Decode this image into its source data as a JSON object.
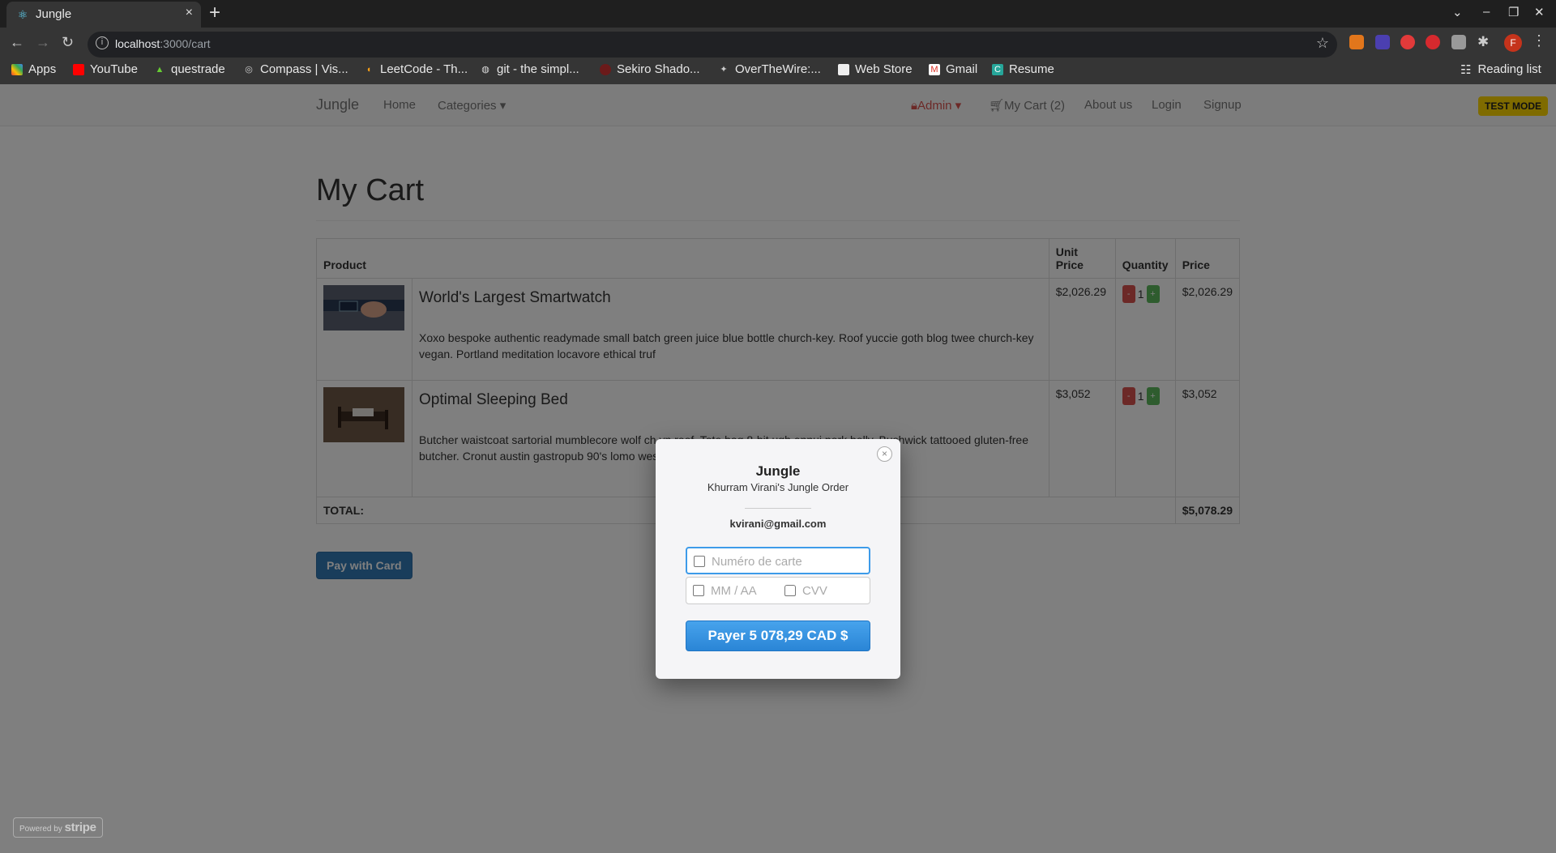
{
  "browser": {
    "tab_title": "Jungle",
    "tab_close": "×",
    "new_tab": "+",
    "url_host": "localhost",
    "url_path": ":3000/cart",
    "bookmarks": [
      "Apps",
      "YouTube",
      "questrade",
      "Compass | Vis...",
      "LeetCode - Th...",
      "git - the simpl...",
      "Sekiro Shado...",
      "OverTheWire:...",
      "Web Store",
      "Gmail",
      "Resume"
    ],
    "reading_list": "Reading list",
    "profile_initial": "F"
  },
  "navbar": {
    "brand": "Jungle",
    "home": "Home",
    "categories": "Categories ▾",
    "admin": "Admin ▾",
    "cart": "My Cart (2)",
    "about": "About us",
    "login": "Login",
    "signup": "Signup"
  },
  "test_mode": "TEST MODE",
  "page_title": "My Cart",
  "table": {
    "headers": {
      "product": "Product",
      "unit_price": "Unit Price",
      "quantity": "Quantity",
      "price": "Price"
    },
    "rows": [
      {
        "name": "World's Largest Smartwatch",
        "description": "Xoxo bespoke authentic readymade small batch green juice blue bottle church-key. Roof yuccie goth blog twee church-key vegan. Portland meditation locavore ethical truf",
        "unit_price": "$2,026.29",
        "quantity": "1",
        "price": "$2,026.29"
      },
      {
        "name": "Optimal Sleeping Bed",
        "description": "Butcher waistcoat sartorial mumblecore wolf ch                                                                              yn roof. Tote bag 8-bit ugh ennui pork belly. Bushwick tattooed gluten-free                                                              butcher. Cronut austin gastropub 90's lomo wes anderson hashtag tac",
        "unit_price": "$3,052",
        "quantity": "1",
        "price": "$3,052"
      }
    ],
    "minus": "-",
    "plus": "+",
    "total_label": "TOTAL:",
    "total_value": "$5,078.29"
  },
  "pay_button": "Pay with Card",
  "powered_by": {
    "prefix": "Powered by",
    "brand": "stripe"
  },
  "modal": {
    "title": "Jungle",
    "subtitle": "Khurram Virani's Jungle Order",
    "email": "kvirani@gmail.com",
    "card_placeholder": "Numéro de carte",
    "expiry_placeholder": "MM / AA",
    "cvv_placeholder": "CVV",
    "pay_label": "Payer 5 078,29 CAD $",
    "close": "×"
  }
}
